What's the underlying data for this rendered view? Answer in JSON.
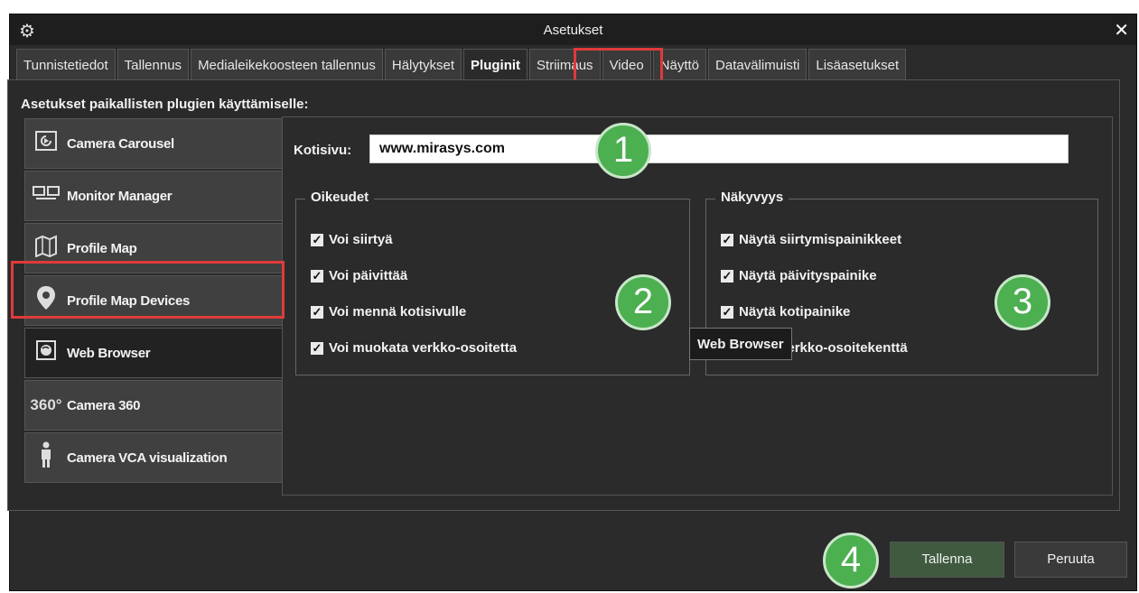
{
  "window": {
    "title": "Asetukset",
    "app_icon": "gears-icon",
    "close_label": "✕"
  },
  "tabs": [
    {
      "label": "Tunnistetiedot"
    },
    {
      "label": "Tallennus"
    },
    {
      "label": "Medialeikekoosteen tallennus"
    },
    {
      "label": "Hälytykset"
    },
    {
      "label": "Pluginit",
      "active": true
    },
    {
      "label": "Striimaus"
    },
    {
      "label": "Video"
    },
    {
      "label": "Näyttö"
    },
    {
      "label": "Datavälimuisti"
    },
    {
      "label": "Lisäasetukset"
    }
  ],
  "section_title": "Asetukset paikallisten plugien käyttämiselle:",
  "plugins": [
    {
      "label": "Camera Carousel",
      "icon": "carousel-icon"
    },
    {
      "label": "Monitor Manager",
      "icon": "monitor-icon"
    },
    {
      "label": "Profile Map",
      "icon": "map-icon"
    },
    {
      "label": "Profile Map Devices",
      "icon": "map-pin-icon"
    },
    {
      "label": "Web Browser",
      "icon": "globe-icon",
      "selected": true
    },
    {
      "label": "Camera 360",
      "icon": "360-icon"
    },
    {
      "label": "Camera VCA visualization",
      "icon": "person-icon"
    }
  ],
  "browser": {
    "home_label": "Kotisivu:",
    "home_value": "www.mirasys.com",
    "rights": {
      "title": "Oikeudet",
      "items": [
        "Voi siirtyä",
        "Voi päivittää",
        "Voi mennä kotisivulle",
        "Voi muokata verkko-osoitetta"
      ]
    },
    "visibility": {
      "title": "Näkyvyys",
      "items": [
        "Näytä siirtymispainikkeet",
        "Näytä päivityspainike",
        "Näytä kotipainike",
        "Näytä verkko-osoitekenttä"
      ]
    }
  },
  "tooltip": "Web Browser",
  "badges": [
    "1",
    "2",
    "3",
    "4"
  ],
  "buttons": {
    "save": "Tallenna",
    "cancel": "Peruuta"
  },
  "colors": {
    "highlight": "#e03a3a",
    "badge": "#4caf50",
    "save_button": "#3f5a3f"
  }
}
